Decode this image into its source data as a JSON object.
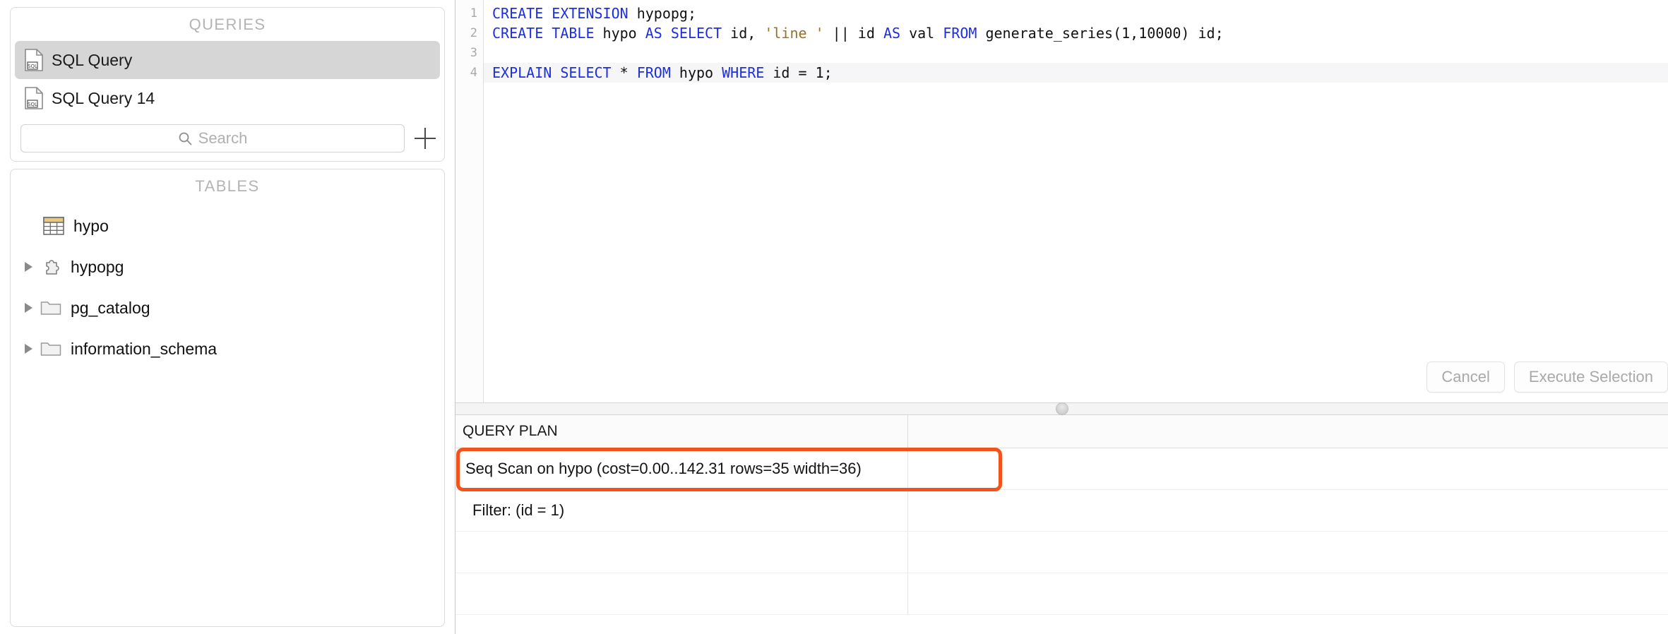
{
  "sidebar": {
    "queries_panel": {
      "title": "QUERIES",
      "items": [
        {
          "label": "SQL Query",
          "icon": "sql-document-icon",
          "selected": true
        },
        {
          "label": "SQL Query 14",
          "icon": "sql-document-icon",
          "selected": false
        }
      ],
      "search": {
        "placeholder": "Search",
        "value": "",
        "icon": "search-icon"
      },
      "add_button": {
        "icon": "plus-icon",
        "label": "+"
      }
    },
    "tables_panel": {
      "title": "TABLES",
      "items": [
        {
          "label": "hypo",
          "icon": "table-icon",
          "expandable": false,
          "expanded": false
        },
        {
          "label": "hypopg",
          "icon": "extension-puzzle-icon",
          "expandable": true,
          "expanded": false
        },
        {
          "label": "pg_catalog",
          "icon": "folder-icon",
          "expandable": true,
          "expanded": false
        },
        {
          "label": "information_schema",
          "icon": "folder-icon",
          "expandable": true,
          "expanded": false
        }
      ]
    }
  },
  "editor": {
    "line_numbers": [
      "1",
      "2",
      "3",
      "4"
    ],
    "lines": [
      [
        {
          "t": "CREATE EXTENSION",
          "c": "kw"
        },
        {
          "t": " hypopg;",
          "c": "id"
        }
      ],
      [
        {
          "t": "CREATE TABLE",
          "c": "kw"
        },
        {
          "t": " hypo ",
          "c": "id"
        },
        {
          "t": "AS SELECT",
          "c": "kw"
        },
        {
          "t": " id, ",
          "c": "id"
        },
        {
          "t": "'line '",
          "c": "str"
        },
        {
          "t": " || id ",
          "c": "id"
        },
        {
          "t": "AS",
          "c": "kw"
        },
        {
          "t": " val ",
          "c": "id"
        },
        {
          "t": "FROM",
          "c": "kw"
        },
        {
          "t": " generate_series(1,10000) id;",
          "c": "id"
        }
      ],
      [],
      [
        {
          "t": "EXPLAIN SELECT",
          "c": "kw"
        },
        {
          "t": " * ",
          "c": "id"
        },
        {
          "t": "FROM",
          "c": "kw"
        },
        {
          "t": " hypo ",
          "c": "id"
        },
        {
          "t": "WHERE",
          "c": "kw"
        },
        {
          "t": " id = 1;",
          "c": "id"
        }
      ]
    ],
    "plain_text": [
      "CREATE EXTENSION hypopg;",
      "CREATE TABLE hypo AS SELECT id, 'line ' || id AS val FROM generate_series(1,10000) id;",
      "",
      "EXPLAIN SELECT * FROM hypo WHERE id = 1;"
    ],
    "current_line": 4,
    "buttons": [
      {
        "label": "Cancel",
        "enabled": false
      },
      {
        "label": "Execute Selection",
        "enabled": false
      }
    ]
  },
  "results": {
    "columns": [
      "QUERY PLAN",
      ""
    ],
    "rows": [
      {
        "cells": [
          "Seq Scan on hypo  (cost=0.00..142.31 rows=35 width=36)",
          ""
        ],
        "indent": false,
        "highlighted": true
      },
      {
        "cells": [
          "Filter: (id = 1)",
          ""
        ],
        "indent": true,
        "highlighted": false
      },
      {
        "cells": [
          "",
          ""
        ],
        "indent": false,
        "highlighted": false
      },
      {
        "cells": [
          "",
          ""
        ],
        "indent": false,
        "highlighted": false
      }
    ]
  },
  "colors": {
    "keyword": "#1c2fe0",
    "string": "#9a7024",
    "identifier": "#111111",
    "highlight_outline": "#f2531b",
    "selection_background": "#d6d6d6",
    "panel_border": "#dcdcdc",
    "table_icon": "#e8c87a",
    "accent_blue": "#3b82f6"
  }
}
